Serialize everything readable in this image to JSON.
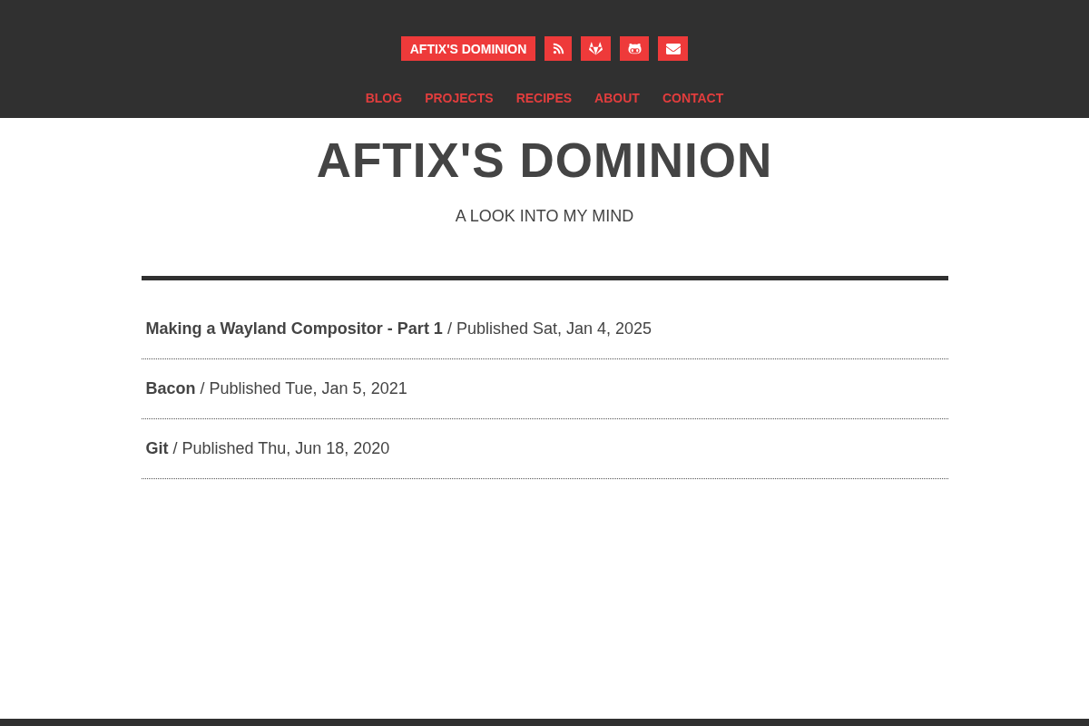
{
  "header": {
    "brand": "AFTIX'S DOMINION",
    "social_links": [
      {
        "kind": "rss"
      },
      {
        "kind": "gitlab"
      },
      {
        "kind": "github"
      },
      {
        "kind": "mail"
      }
    ],
    "nav": [
      {
        "label": "BLOG"
      },
      {
        "label": "PROJECTS"
      },
      {
        "label": "RECIPES"
      },
      {
        "label": "ABOUT"
      },
      {
        "label": "CONTACT"
      }
    ]
  },
  "site": {
    "title": "AFTIX'S DOMINION",
    "tagline": "A LOOK INTO MY MIND"
  },
  "posts": [
    {
      "title": "Making a Wayland Compositor - Part 1",
      "meta": "/ Published Sat, Jan 4, 2025"
    },
    {
      "title": "Bacon",
      "meta": "/ Published Tue, Jan 5, 2021"
    },
    {
      "title": "Git",
      "meta": "/ Published Thu, Jun 18, 2020"
    }
  ]
}
